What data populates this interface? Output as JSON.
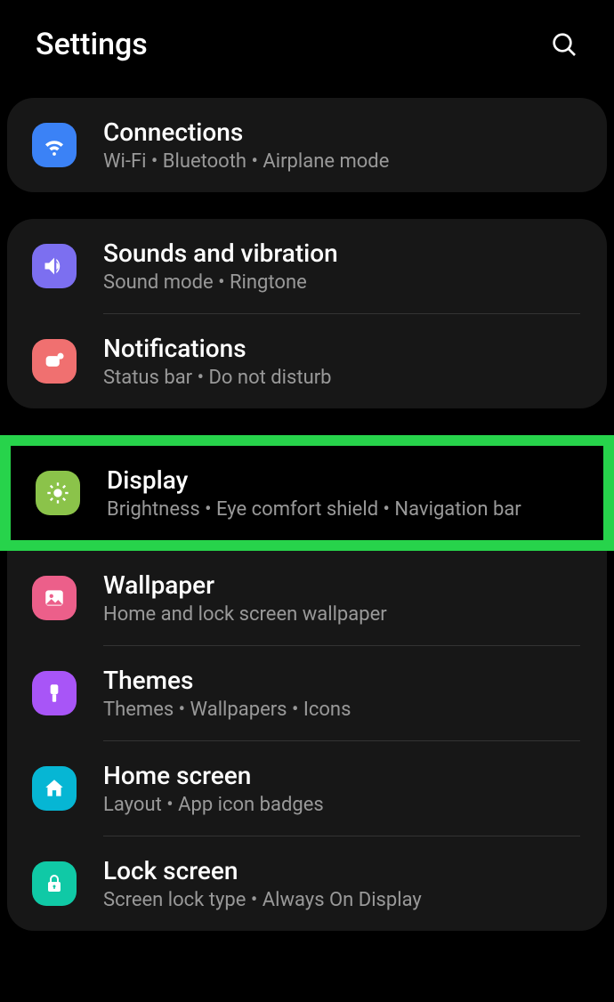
{
  "header": {
    "title": "Settings"
  },
  "groups": [
    {
      "items": [
        {
          "id": "connections",
          "title": "Connections",
          "sub": "Wi-Fi  •  Bluetooth  •  Airplane mode"
        }
      ]
    },
    {
      "items": [
        {
          "id": "sounds",
          "title": "Sounds and vibration",
          "sub": "Sound mode  •  Ringtone"
        },
        {
          "id": "notifications",
          "title": "Notifications",
          "sub": "Status bar  •  Do not disturb"
        }
      ]
    },
    {
      "highlighted": true,
      "items": [
        {
          "id": "display",
          "title": "Display",
          "sub": "Brightness  •  Eye comfort shield  •  Navigation bar"
        }
      ]
    },
    {
      "continuation": true,
      "items": [
        {
          "id": "wallpaper",
          "title": "Wallpaper",
          "sub": "Home and lock screen wallpaper"
        },
        {
          "id": "themes",
          "title": "Themes",
          "sub": "Themes  •  Wallpapers  •  Icons"
        },
        {
          "id": "home",
          "title": "Home screen",
          "sub": "Layout  •  App icon badges"
        },
        {
          "id": "lock",
          "title": "Lock screen",
          "sub": "Screen lock type  •  Always On Display"
        }
      ]
    }
  ]
}
